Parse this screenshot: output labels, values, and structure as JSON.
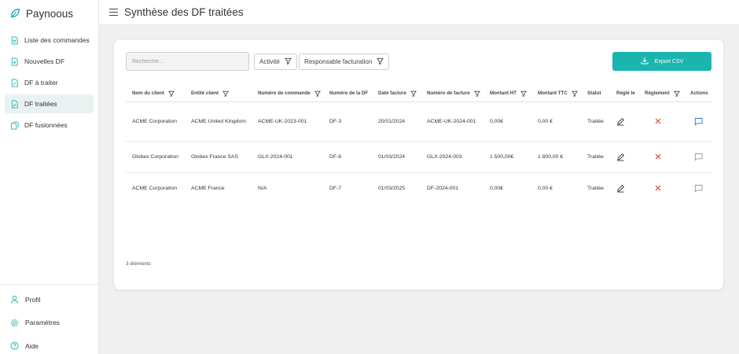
{
  "app": {
    "name": "Paynoous",
    "accent": "#1bb5b0"
  },
  "sidebar": {
    "items": [
      {
        "label": "Liste des commandes",
        "icon": "file-list-icon",
        "active": false
      },
      {
        "label": "Nouvelles DF",
        "icon": "file-add-icon",
        "active": false
      },
      {
        "label": "DF à traiter",
        "icon": "file-edit-icon",
        "active": false
      },
      {
        "label": "DF traitées",
        "icon": "file-check-icon",
        "active": true
      },
      {
        "label": "DF fusionnées",
        "icon": "files-merge-icon",
        "active": false
      }
    ],
    "bottom": [
      {
        "label": "Profil",
        "icon": "user-icon"
      },
      {
        "label": "Paramètres",
        "icon": "gear-icon"
      },
      {
        "label": "Aide",
        "icon": "help-icon"
      }
    ]
  },
  "header": {
    "title": "Synthèse des DF traitées"
  },
  "toolbar": {
    "search_placeholder": "Recherche...",
    "filter_activite": "Activité",
    "filter_responsable": "Responsable facturation",
    "export_label": "Export CSV"
  },
  "table": {
    "columns": [
      {
        "label": "Nom du client",
        "filter": true
      },
      {
        "label": "Entité client",
        "filter": true
      },
      {
        "label": "Numéro de commande",
        "filter": true
      },
      {
        "label": "Numéro de la DF",
        "filter": false
      },
      {
        "label": "Date facture",
        "filter": true
      },
      {
        "label": "Numéro de facture",
        "filter": true
      },
      {
        "label": "Montant HT",
        "filter": true
      },
      {
        "label": "Montant TTC",
        "filter": true
      },
      {
        "label": "Statut",
        "filter": false
      },
      {
        "label": "Réglé le",
        "filter": false
      },
      {
        "label": "Règlement",
        "filter": true
      },
      {
        "label": "Actions",
        "filter": false
      }
    ],
    "rows": [
      {
        "client": "ACME Corporation",
        "entite": "ACME United Kingdom",
        "commande": "ACME-UK-2023-001",
        "df": "DF-3",
        "date": "20/01/2024",
        "facture": "ACME-UK-2024-001",
        "ht": "0,00€",
        "ttc": "0,00 €",
        "statut": "Traitée",
        "comment_color": "#2f6fd6"
      },
      {
        "client": "Globex Corporation",
        "entite": "Globex France SAS",
        "commande": "GLX-2024-001",
        "df": "DF-6",
        "date": "01/03/2024",
        "facture": "GLX-2024-003",
        "ht": "1 500,00€",
        "ttc": "1 800,00 €",
        "statut": "Traitée",
        "comment_color": "#9a9a9a"
      },
      {
        "client": "ACME Corporation",
        "entite": "ACME France",
        "commande": "N/A",
        "df": "DF-7",
        "date": "01/03/2025",
        "facture": "DF-2024-001",
        "ht": "0,00€",
        "ttc": "0,00 €",
        "statut": "Traitée",
        "comment_color": "#9a9a9a"
      }
    ],
    "count_text": "3 éléments"
  }
}
